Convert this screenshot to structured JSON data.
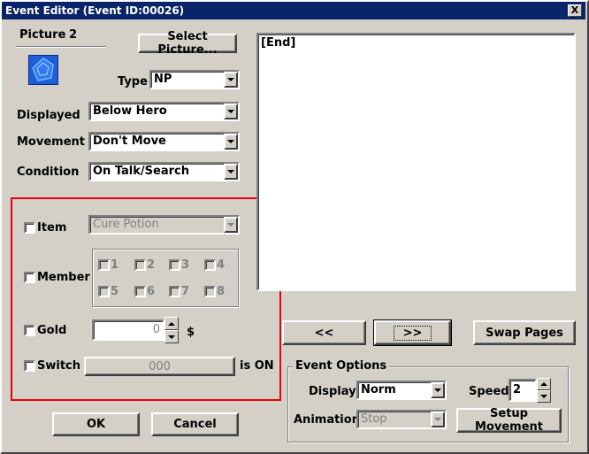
{
  "window": {
    "title": "Event Editor (Event ID:00026)",
    "close_glyph": "X"
  },
  "picture": {
    "label": "Picture",
    "number": "2",
    "select_button": "Select Picture...",
    "sprite_color": "#1c5fd6"
  },
  "type": {
    "label": "Type",
    "value": "NP"
  },
  "displayed": {
    "label": "Displayed",
    "value": "Below Hero"
  },
  "movement": {
    "label": "Movement",
    "value": "Don't Move"
  },
  "condition": {
    "label": "Condition",
    "value": "On Talk/Search"
  },
  "conditions": {
    "highlight_color": "#e8000b",
    "item": {
      "label": "Item",
      "value": "Cure Potion"
    },
    "member": {
      "label": "Member",
      "slots": [
        "1",
        "2",
        "3",
        "4",
        "5",
        "6",
        "7",
        "8"
      ]
    },
    "gold": {
      "label": "Gold",
      "value": "0",
      "unit": "$"
    },
    "switch": {
      "label": "Switch",
      "value": "000",
      "suffix": "is ON"
    }
  },
  "script": {
    "lines": [
      "[End]"
    ]
  },
  "pager": {
    "prev": "<<",
    "next": ">>",
    "swap": "Swap Pages"
  },
  "event_options": {
    "title": "Event Options",
    "display_label": "Display",
    "display_value": "Norm",
    "speed_label": "Speed",
    "speed_value": "2",
    "animation_label": "Animation",
    "animation_value": "Stop",
    "setup_movement": "Setup Movement"
  },
  "footer": {
    "ok": "OK",
    "cancel": "Cancel"
  }
}
